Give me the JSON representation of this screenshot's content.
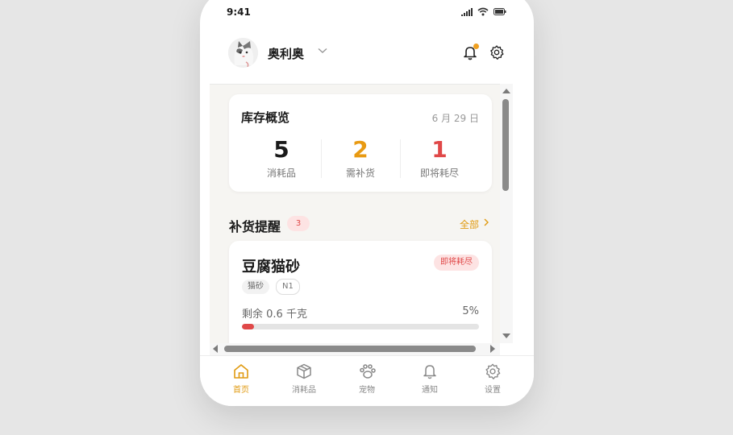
{
  "status": {
    "time": "9:41"
  },
  "header": {
    "pet_name": "奥利奥"
  },
  "overview": {
    "title": "库存概览",
    "date": "6 月 29 日",
    "stats": [
      {
        "value": "5",
        "label": "消耗品",
        "color": "#1a1a1a"
      },
      {
        "value": "2",
        "label": "需补货",
        "color": "#e89a12"
      },
      {
        "value": "1",
        "label": "即将耗尽",
        "color": "#e04848"
      }
    ]
  },
  "restock": {
    "title": "补货提醒",
    "count": "3",
    "all_label": "全部"
  },
  "item": {
    "name": "豆腐猫砂",
    "status": "即将耗尽",
    "tags": [
      "猫砂",
      "N1"
    ],
    "remaining": "剩余 0.6 千克",
    "percent": "5%",
    "level": 0.05
  },
  "tabs": [
    {
      "label": "首页",
      "icon": "home-icon",
      "active": true
    },
    {
      "label": "消耗品",
      "icon": "box-icon",
      "active": false
    },
    {
      "label": "宠物",
      "icon": "paw-icon",
      "active": false
    },
    {
      "label": "通知",
      "icon": "bell-icon",
      "active": false
    },
    {
      "label": "设置",
      "icon": "gear-icon",
      "active": false
    }
  ],
  "colors": {
    "accent": "#e89a12",
    "danger": "#e04848"
  }
}
